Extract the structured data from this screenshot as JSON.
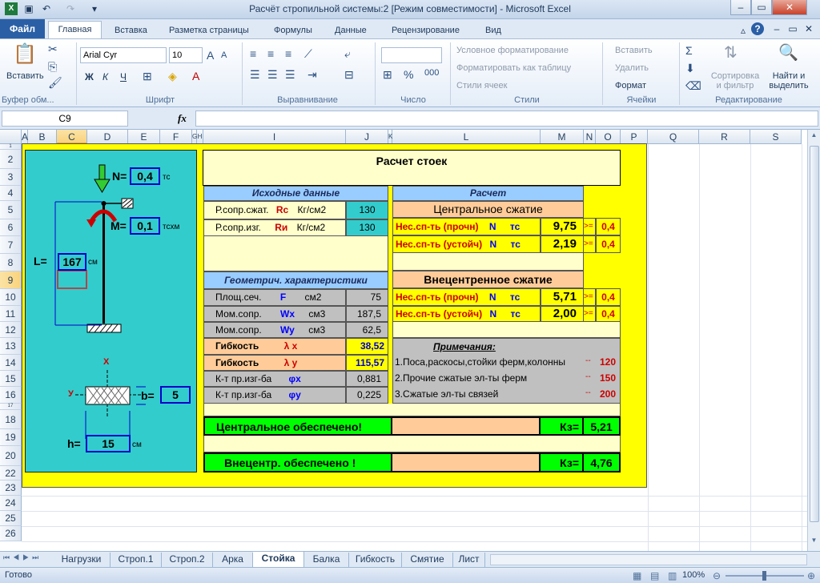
{
  "window": {
    "title": "Расчёт стропильной системы:2  [Режим совместимости]  -  Microsoft Excel"
  },
  "ribbon_tabs": [
    "Файл",
    "Главная",
    "Вставка",
    "Разметка страницы",
    "Формулы",
    "Данные",
    "Рецензирование",
    "Вид"
  ],
  "ribbon": {
    "paste": "Вставить",
    "font_name": "Arial Cyr",
    "font_size": "10",
    "bold": "Ж",
    "italic": "К",
    "underline": "Ч",
    "cond_format": "Условное форматирование",
    "format_table": "Форматировать как таблицу",
    "cell_styles": "Стили ячеек",
    "insert": "Вставить",
    "delete": "Удалить",
    "format": "Формат",
    "sort": "Сортировка и фильтр",
    "find": "Найти и выделить",
    "groups": {
      "clipboard": "Буфер обм...",
      "font": "Шрифт",
      "align": "Выравнивание",
      "number": "Число",
      "styles": "Стили",
      "cells": "Ячейки",
      "edit": "Редактирование"
    }
  },
  "formula_bar": {
    "name_box": "C9",
    "fx": "fx",
    "formula": ""
  },
  "columns": [
    "A",
    "B",
    "C",
    "D",
    "E",
    "F",
    "G",
    "H",
    "I",
    "J",
    "K",
    "L",
    "M",
    "N",
    "O",
    "P",
    "Q",
    "R",
    "S"
  ],
  "rows": [
    "1",
    "2",
    "3",
    "4",
    "5",
    "6",
    "7",
    "8",
    "9",
    "10",
    "11",
    "12",
    "13",
    "14",
    "15",
    "16",
    "17",
    "18",
    "19",
    "20",
    "22",
    "23",
    "24",
    "25",
    "26"
  ],
  "diagram": {
    "N_label": "N=",
    "N_value": "0,4",
    "N_unit": "тс",
    "M_label": "M=",
    "M_value": "0,1",
    "M_unit": "тсхм",
    "L_label": "L=",
    "L_value": "167",
    "L_unit": "см",
    "x_axis": "X",
    "y_axis": "У",
    "b_label": "b=",
    "b_value": "5",
    "h_label": "h=",
    "h_value": "15",
    "h_unit": "см"
  },
  "calc": {
    "title": "Расчет стоек",
    "input_header": "Исходные данные",
    "calc_header": "Расчет",
    "rc_label": "Р.сопр.сжат.",
    "rc_sym": "Rc",
    "rc_unit": "Кг/см2",
    "rc_value": "130",
    "ri_label": "Р.сопр.изг.",
    "ri_sym": "Rи",
    "ri_unit": "Кг/см2",
    "ri_value": "130",
    "central_title": "Центральное сжатие",
    "central_rows": [
      {
        "label": "Нес.сп-ть (прочн)",
        "n": "N",
        "unit": "тс",
        "value": "9,75",
        "cmp": ">=",
        "limit": "0,4"
      },
      {
        "label": "Нес.сп-ть (устойч)",
        "n": "N",
        "unit": "тс",
        "value": "2,19",
        "cmp": ">=",
        "limit": "0,4"
      }
    ],
    "geom_header": "Геометрич. характеристики",
    "eccentric_title": "Внецентренное сжатие",
    "eccentric_rows": [
      {
        "label": "Нес.сп-ть (прочн)",
        "n": "N",
        "unit": "тс",
        "value": "5,71",
        "cmp": ">=",
        "limit": "0,4"
      },
      {
        "label": "Нес.сп-ть (устойч)",
        "n": "N",
        "unit": "тс",
        "value": "2,00",
        "cmp": ">=",
        "limit": "0,4"
      }
    ],
    "geom_rows": [
      {
        "label": "Площ.сеч.",
        "sym": "F",
        "unit": "см2",
        "value": "75"
      },
      {
        "label": "Мом.сопр.",
        "sym": "Wx",
        "unit": "см3",
        "value": "187,5"
      },
      {
        "label": "Мом.сопр.",
        "sym": "Wy",
        "unit": "см3",
        "value": "62,5"
      }
    ],
    "flex_rows": [
      {
        "label": "Гибкость",
        "sym": "λ x",
        "value": "38,52"
      },
      {
        "label": "Гибкость",
        "sym": "λ y",
        "value": "115,57"
      }
    ],
    "coef_rows": [
      {
        "label": "К-т пр.изг-ба",
        "sym": "φx",
        "value": "0,881"
      },
      {
        "label": "К-т пр.изг-ба",
        "sym": "φy",
        "value": "0,225"
      }
    ],
    "notes_title": "Примечания:",
    "notes": [
      {
        "text": "1.Поса,раскосы,стойки ферм,колонны",
        "dash": "--",
        "value": "120"
      },
      {
        "text": "2.Прочие сжатые эл-ты ферм",
        "dash": "--",
        "value": "150"
      },
      {
        "text": "3.Сжатые эл-ты связей",
        "dash": "--",
        "value": "200"
      }
    ],
    "result1": "Центральное  обеспечено!",
    "k1_label": "Кз=",
    "k1_value": "5,21",
    "result2": "Внецентр. обеспечено !",
    "k2_label": "Кз=",
    "k2_value": "4,76"
  },
  "sheet_tabs": [
    "Нагрузки",
    "Строп.1",
    "Строп.2",
    "Арка",
    "Стойка",
    "Балка",
    "Гибкость",
    "Смятие",
    "Лист"
  ],
  "status": {
    "ready": "Готово",
    "zoom": "100%"
  }
}
